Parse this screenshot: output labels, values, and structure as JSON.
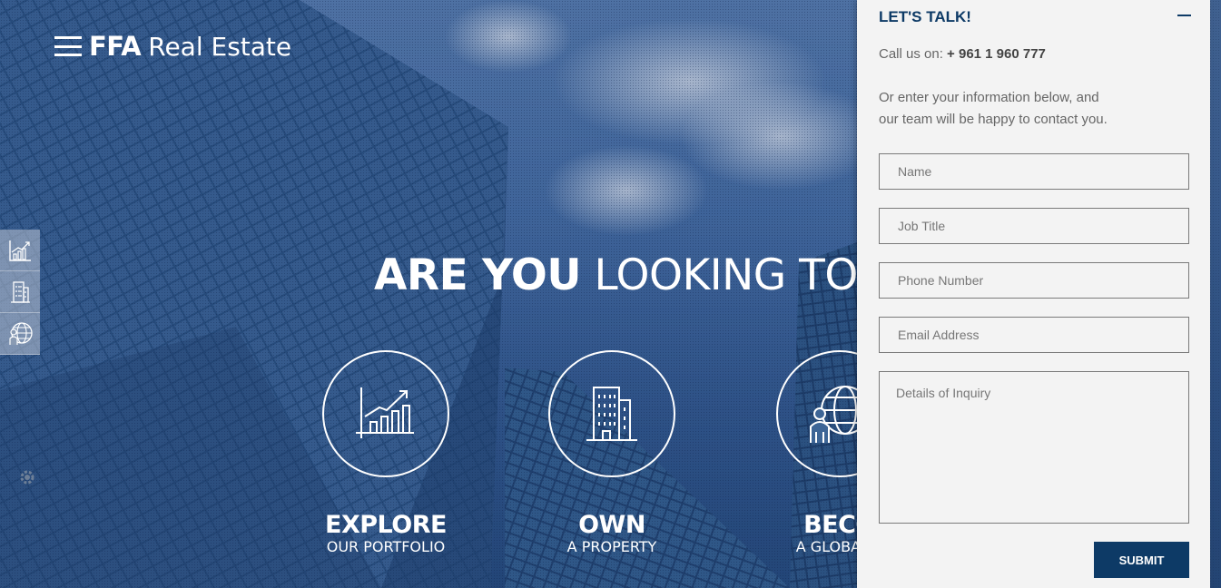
{
  "brand": {
    "name": "FFA",
    "suffix": "Real Estate"
  },
  "hero": {
    "headline_bold": "ARE YOU",
    "headline_light": "LOOKING TO"
  },
  "side_tabs": [
    {
      "icon": "growth-chart-icon"
    },
    {
      "icon": "building-icon"
    },
    {
      "icon": "globe-person-icon"
    }
  ],
  "features": [
    {
      "title": "EXPLORE",
      "sub": "OUR PORTFOLIO",
      "icon": "growth-chart-icon"
    },
    {
      "title": "OWN",
      "sub": "A PROPERTY",
      "icon": "building-icon"
    },
    {
      "title": "BECO",
      "sub": "A GLOBAL C",
      "icon": "globe-person-icon"
    }
  ],
  "contact": {
    "title": "LET'S TALK!",
    "call_label": "Call us on:",
    "phone": "+ 961 1 960 777",
    "intro_line1": "Or enter your information below, and",
    "intro_line2": "our team will be happy to contact you.",
    "fields": {
      "name": "Name",
      "job_title": "Job Title",
      "phone": "Phone Number",
      "email": "Email Address",
      "details": "Details of Inquiry"
    },
    "submit_label": "SUBMIT"
  },
  "colors": {
    "panel_bg": "#f3f3f3",
    "accent": "#0d3a66",
    "hero_tint": "#3a6396"
  }
}
